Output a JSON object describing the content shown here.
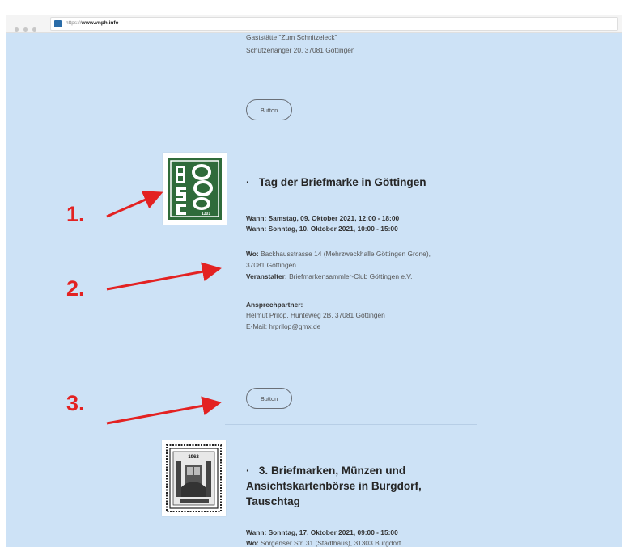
{
  "browser": {
    "url_prefix": "https://",
    "url_host": "www.vnph.info"
  },
  "top_entry": {
    "venue_line1": "Gaststätte \"Zum Schnitzeleck\"",
    "venue_line2": "Schützenanger 20, 37081 Göttingen",
    "button_label": "Button"
  },
  "event1": {
    "logo_text": "1301",
    "title": "Tag der Briefmarke in Göttingen",
    "bullet": "·",
    "wann1": "Wann: Samstag, 09. Oktober 2021, 12:00 - 18:00",
    "wann2": "Wann: Sonntag, 10. Oktober 2021, 10:00 - 15:00",
    "wo_label": "Wo:",
    "wo_value": " Backhausstrasse 14 (Mehrzweckhalle Göttingen Grone),",
    "wo_value2": "37081 Göttingen",
    "veranstalter_label": "Veranstalter:",
    "veranstalter_value": " Briefmarkensammler-Club Göttingen e.V.",
    "ansprech_label": "Ansprechpartner:",
    "ansprech_line1": "Helmut Prilop, Hunteweg 2B, 37081 Göttingen",
    "ansprech_line2": "E-Mail: hrprilop@gmx.de",
    "button_label": "Button"
  },
  "event2": {
    "logo_year": "1962",
    "title_line1": "3. Briefmarken, Münzen und",
    "title_line2": "Ansichtskartenbörse in Burgdorf,",
    "title_line3": "Tauschtag",
    "bullet": "·",
    "wann1": "Wann: Sonntag, 17. Oktober 2021, 09:00 - 15:00",
    "wo_label": "Wo:",
    "wo_value": " Sorgenser Str. 31 (Stadthaus), 31303 Burgdorf"
  },
  "annotations": [
    {
      "label": "1."
    },
    {
      "label": "2."
    },
    {
      "label": "3."
    }
  ],
  "colors": {
    "page_bg": "#cde2f6",
    "annotation_red": "#e32222",
    "logo_green": "#2f6b3a"
  }
}
